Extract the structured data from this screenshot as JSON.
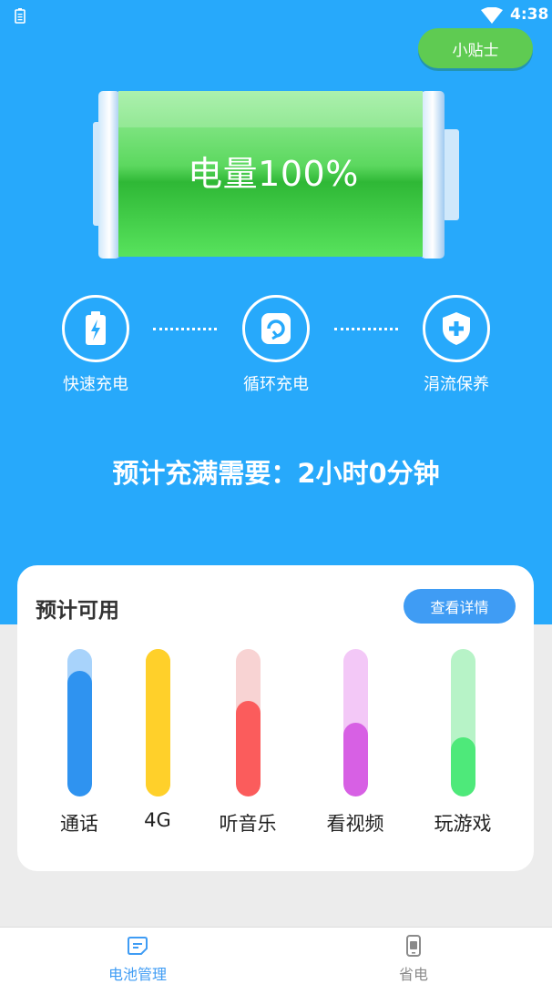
{
  "status_bar": {
    "time": "4:38"
  },
  "header": {
    "tips_label": "小贴士"
  },
  "battery": {
    "label": "电量100%",
    "level": 100,
    "fill_color": "#44d44c"
  },
  "features": [
    {
      "label": "快速充电",
      "icon": "lightning-battery-icon"
    },
    {
      "label": "循环充电",
      "icon": "cycle-icon"
    },
    {
      "label": "涓流保养",
      "icon": "shield-plus-icon"
    }
  ],
  "estimate": {
    "text": "预计充满需要：2小时0分钟"
  },
  "usage_card": {
    "title": "预计可用",
    "detail_label": "查看详情",
    "items": [
      {
        "label": "通话",
        "level": 0.85,
        "fill": "#2f93f0",
        "track": "#a8d3fb"
      },
      {
        "label": "4G",
        "level": 1.0,
        "fill": "#ffd02a",
        "track": "#ffd02a"
      },
      {
        "label": "听音乐",
        "level": 0.65,
        "fill": "#fb5c5c",
        "track": "#f8d3d3"
      },
      {
        "label": "看视频",
        "level": 0.5,
        "fill": "#d760e4",
        "track": "#f3c8f7"
      },
      {
        "label": "玩游戏",
        "level": 0.4,
        "fill": "#4ee97a",
        "track": "#b7f3c7"
      }
    ]
  },
  "bottom_nav": [
    {
      "label": "电池管理",
      "icon": "battery-manage-icon",
      "active": true,
      "color": "#3f9cf4"
    },
    {
      "label": "省电",
      "icon": "phone-icon",
      "active": false,
      "color": "#8a8a8a"
    }
  ]
}
